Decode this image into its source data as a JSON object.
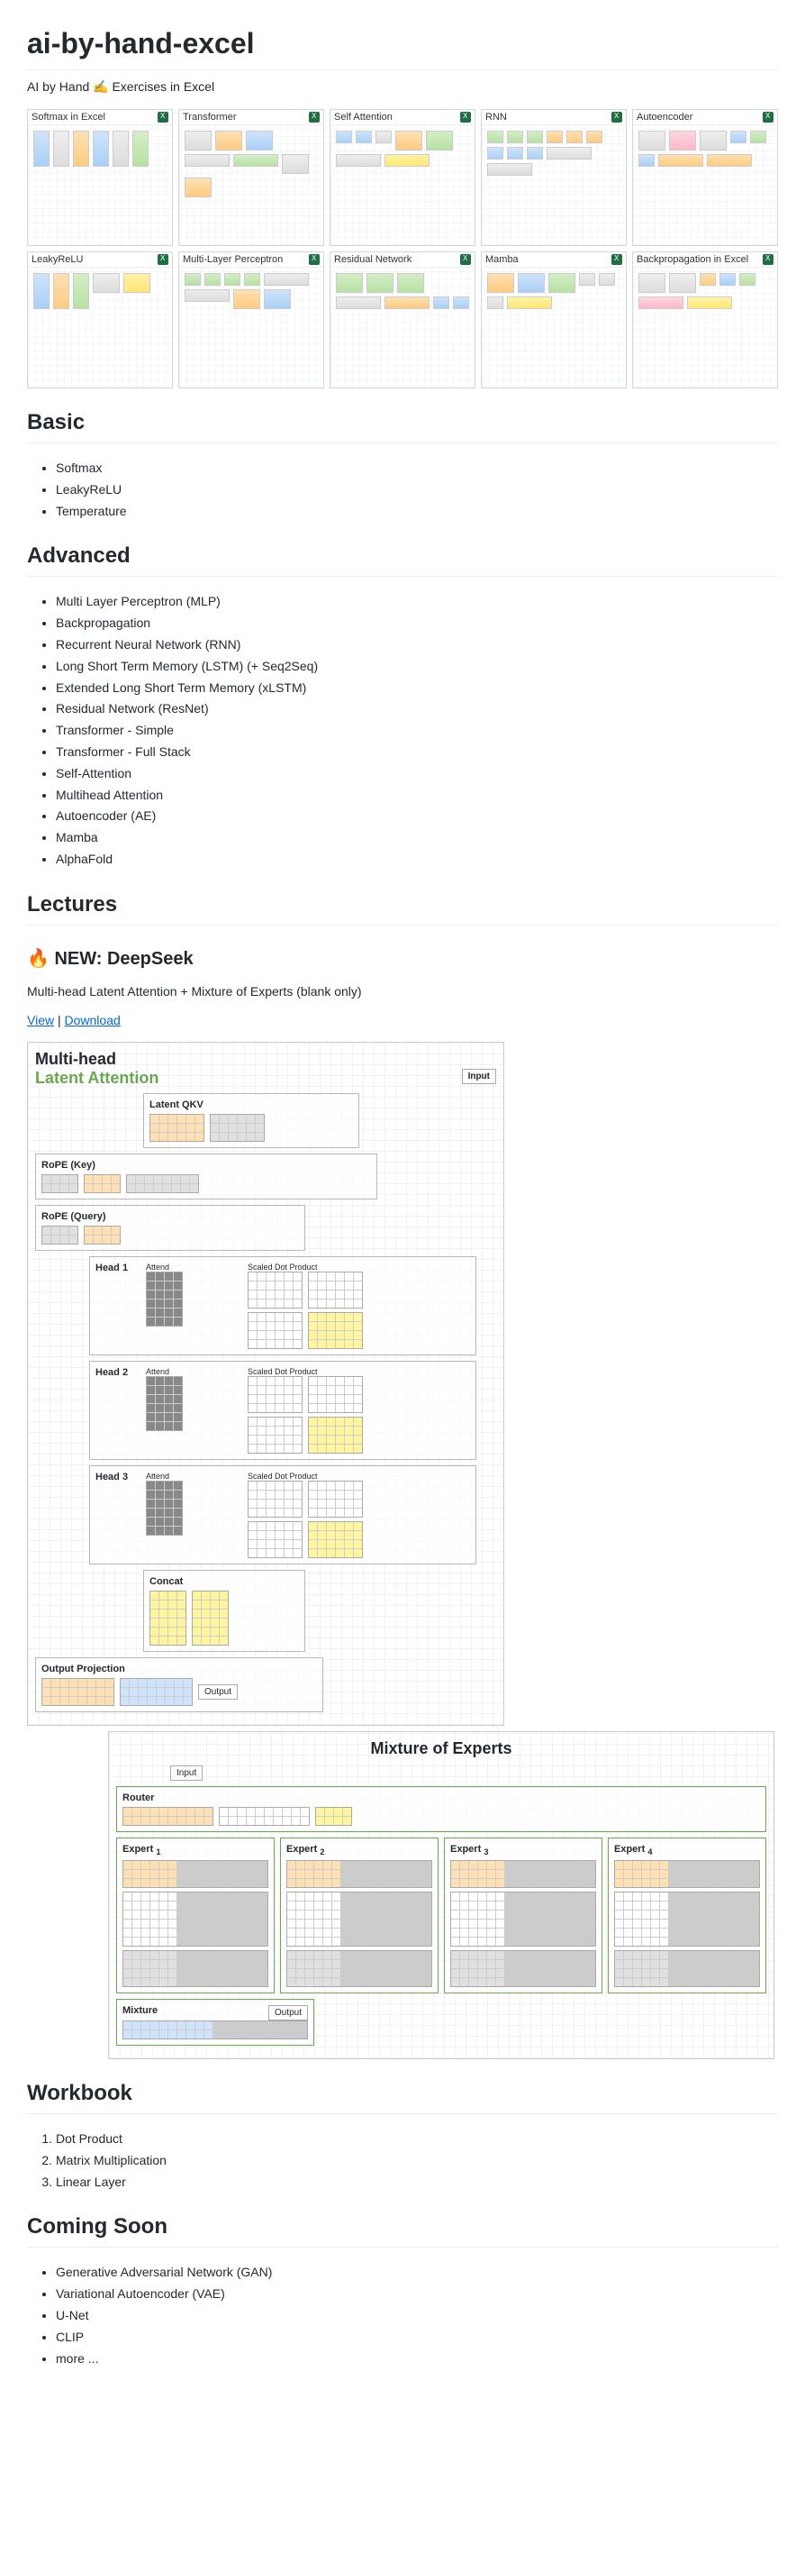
{
  "title": "ai-by-hand-excel",
  "subtitle": "AI by Hand ✍️ Exercises in Excel",
  "thumbnails": [
    "Softmax in Excel",
    "Transformer",
    "Self Attention",
    "RNN",
    "Autoencoder",
    "LeakyReLU",
    "Multi-Layer Perceptron",
    "Residual Network",
    "Mamba",
    "Backpropagation in Excel"
  ],
  "sections": {
    "basic": {
      "heading": "Basic",
      "items": [
        "Softmax",
        "LeakyReLU",
        "Temperature"
      ]
    },
    "advanced": {
      "heading": "Advanced",
      "items": [
        "Multi Layer Perceptron (MLP)",
        "Backpropagation",
        "Recurrent Neural Network (RNN)",
        "Long Short Term Memory (LSTM) (+ Seq2Seq)",
        "Extended Long Short Term Memory (xLSTM)",
        "Residual Network (ResNet)",
        "Transformer - Simple",
        "Transformer - Full Stack",
        "Self-Attention",
        "Multihead Attention",
        "Autoencoder (AE)",
        "Mamba",
        "AlphaFold"
      ]
    },
    "lectures": {
      "heading": "Lectures",
      "new_label": "🔥 NEW: DeepSeek",
      "new_desc": "Multi-head Latent Attention + Mixture of Experts (blank only)",
      "view": "View",
      "download": "Download",
      "mla": {
        "title_a": "Multi-head",
        "title_b": "Latent ",
        "title_c": "Attention",
        "input": "Input",
        "latent_qkv": "Latent QKV",
        "rope_key": "RoPE (Key)",
        "rope_query": "RoPE (Query)",
        "head1": "Head 1",
        "head2": "Head 2",
        "head3": "Head 3",
        "attend": "Attend",
        "sdp": "Scaled Dot Product",
        "concat": "Concat",
        "out_proj": "Output Projection",
        "output": "Output"
      },
      "moe": {
        "title": "Mixture of Experts",
        "input": "Input",
        "router": "Router",
        "expert": "Expert",
        "mixture": "Mixture",
        "output": "Output"
      }
    },
    "workbook": {
      "heading": "Workbook",
      "items": [
        "Dot Product",
        "Matrix Multiplication",
        "Linear Layer"
      ]
    },
    "coming_soon": {
      "heading": "Coming Soon",
      "items": [
        "Generative Adversarial Network (GAN)",
        "Variational Autoencoder (VAE)",
        "U-Net",
        "CLIP",
        "more ..."
      ]
    }
  }
}
